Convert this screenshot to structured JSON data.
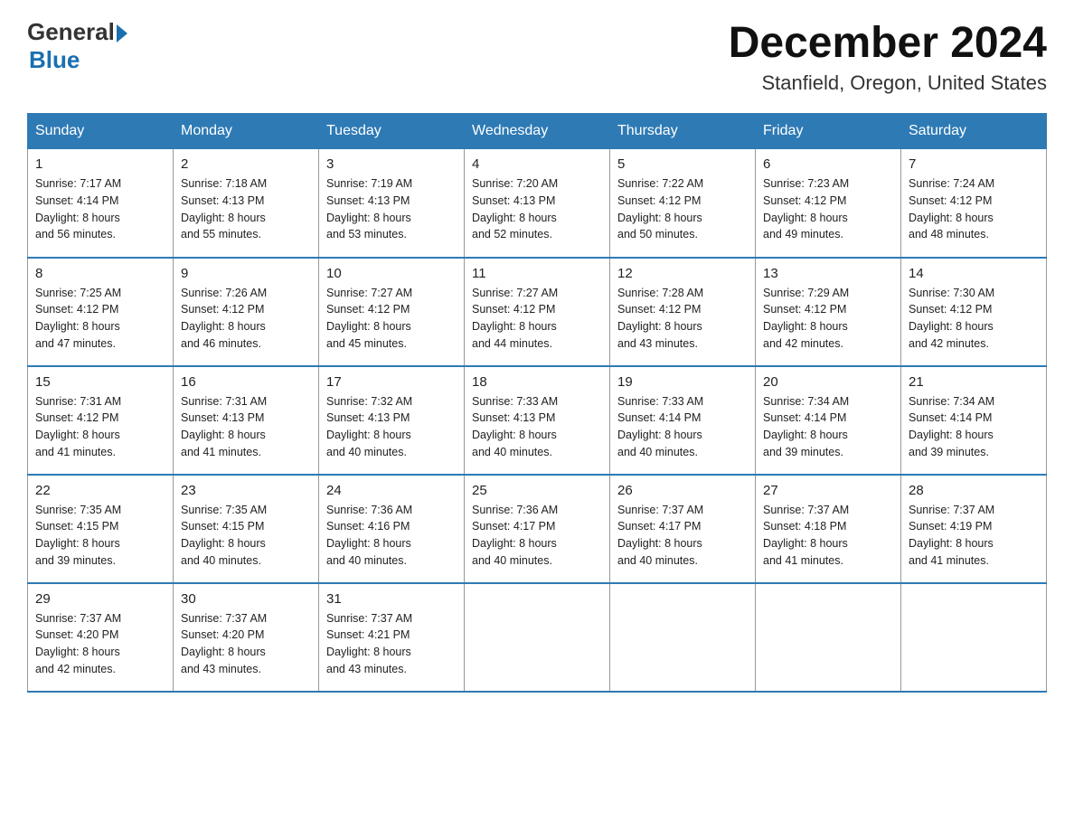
{
  "header": {
    "logo_general": "General",
    "logo_blue": "Blue",
    "month_year": "December 2024",
    "location": "Stanfield, Oregon, United States"
  },
  "days_of_week": [
    "Sunday",
    "Monday",
    "Tuesday",
    "Wednesday",
    "Thursday",
    "Friday",
    "Saturday"
  ],
  "weeks": [
    [
      {
        "day": "1",
        "sunrise": "7:17 AM",
        "sunset": "4:14 PM",
        "daylight": "8 hours and 56 minutes."
      },
      {
        "day": "2",
        "sunrise": "7:18 AM",
        "sunset": "4:13 PM",
        "daylight": "8 hours and 55 minutes."
      },
      {
        "day": "3",
        "sunrise": "7:19 AM",
        "sunset": "4:13 PM",
        "daylight": "8 hours and 53 minutes."
      },
      {
        "day": "4",
        "sunrise": "7:20 AM",
        "sunset": "4:13 PM",
        "daylight": "8 hours and 52 minutes."
      },
      {
        "day": "5",
        "sunrise": "7:22 AM",
        "sunset": "4:12 PM",
        "daylight": "8 hours and 50 minutes."
      },
      {
        "day": "6",
        "sunrise": "7:23 AM",
        "sunset": "4:12 PM",
        "daylight": "8 hours and 49 minutes."
      },
      {
        "day": "7",
        "sunrise": "7:24 AM",
        "sunset": "4:12 PM",
        "daylight": "8 hours and 48 minutes."
      }
    ],
    [
      {
        "day": "8",
        "sunrise": "7:25 AM",
        "sunset": "4:12 PM",
        "daylight": "8 hours and 47 minutes."
      },
      {
        "day": "9",
        "sunrise": "7:26 AM",
        "sunset": "4:12 PM",
        "daylight": "8 hours and 46 minutes."
      },
      {
        "day": "10",
        "sunrise": "7:27 AM",
        "sunset": "4:12 PM",
        "daylight": "8 hours and 45 minutes."
      },
      {
        "day": "11",
        "sunrise": "7:27 AM",
        "sunset": "4:12 PM",
        "daylight": "8 hours and 44 minutes."
      },
      {
        "day": "12",
        "sunrise": "7:28 AM",
        "sunset": "4:12 PM",
        "daylight": "8 hours and 43 minutes."
      },
      {
        "day": "13",
        "sunrise": "7:29 AM",
        "sunset": "4:12 PM",
        "daylight": "8 hours and 42 minutes."
      },
      {
        "day": "14",
        "sunrise": "7:30 AM",
        "sunset": "4:12 PM",
        "daylight": "8 hours and 42 minutes."
      }
    ],
    [
      {
        "day": "15",
        "sunrise": "7:31 AM",
        "sunset": "4:12 PM",
        "daylight": "8 hours and 41 minutes."
      },
      {
        "day": "16",
        "sunrise": "7:31 AM",
        "sunset": "4:13 PM",
        "daylight": "8 hours and 41 minutes."
      },
      {
        "day": "17",
        "sunrise": "7:32 AM",
        "sunset": "4:13 PM",
        "daylight": "8 hours and 40 minutes."
      },
      {
        "day": "18",
        "sunrise": "7:33 AM",
        "sunset": "4:13 PM",
        "daylight": "8 hours and 40 minutes."
      },
      {
        "day": "19",
        "sunrise": "7:33 AM",
        "sunset": "4:14 PM",
        "daylight": "8 hours and 40 minutes."
      },
      {
        "day": "20",
        "sunrise": "7:34 AM",
        "sunset": "4:14 PM",
        "daylight": "8 hours and 39 minutes."
      },
      {
        "day": "21",
        "sunrise": "7:34 AM",
        "sunset": "4:14 PM",
        "daylight": "8 hours and 39 minutes."
      }
    ],
    [
      {
        "day": "22",
        "sunrise": "7:35 AM",
        "sunset": "4:15 PM",
        "daylight": "8 hours and 39 minutes."
      },
      {
        "day": "23",
        "sunrise": "7:35 AM",
        "sunset": "4:15 PM",
        "daylight": "8 hours and 40 minutes."
      },
      {
        "day": "24",
        "sunrise": "7:36 AM",
        "sunset": "4:16 PM",
        "daylight": "8 hours and 40 minutes."
      },
      {
        "day": "25",
        "sunrise": "7:36 AM",
        "sunset": "4:17 PM",
        "daylight": "8 hours and 40 minutes."
      },
      {
        "day": "26",
        "sunrise": "7:37 AM",
        "sunset": "4:17 PM",
        "daylight": "8 hours and 40 minutes."
      },
      {
        "day": "27",
        "sunrise": "7:37 AM",
        "sunset": "4:18 PM",
        "daylight": "8 hours and 41 minutes."
      },
      {
        "day": "28",
        "sunrise": "7:37 AM",
        "sunset": "4:19 PM",
        "daylight": "8 hours and 41 minutes."
      }
    ],
    [
      {
        "day": "29",
        "sunrise": "7:37 AM",
        "sunset": "4:20 PM",
        "daylight": "8 hours and 42 minutes."
      },
      {
        "day": "30",
        "sunrise": "7:37 AM",
        "sunset": "4:20 PM",
        "daylight": "8 hours and 43 minutes."
      },
      {
        "day": "31",
        "sunrise": "7:37 AM",
        "sunset": "4:21 PM",
        "daylight": "8 hours and 43 minutes."
      },
      null,
      null,
      null,
      null
    ]
  ],
  "labels": {
    "sunrise": "Sunrise: ",
    "sunset": "Sunset: ",
    "daylight": "Daylight: "
  }
}
